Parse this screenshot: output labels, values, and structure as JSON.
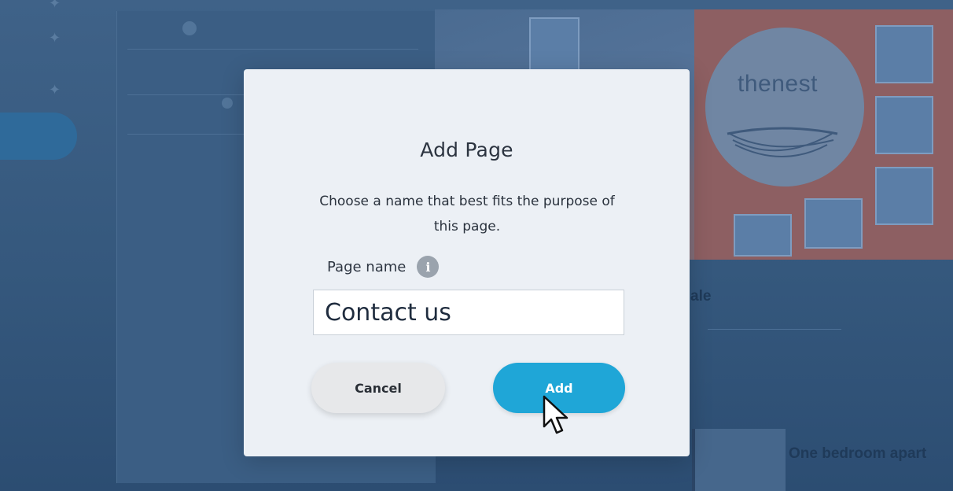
{
  "background": {
    "logo_text": "thenest",
    "heading_partial": "ale",
    "card_title": "One bedroom apart"
  },
  "dialog": {
    "title": "Add Page",
    "description": "Choose a name that best fits the purpose of this page.",
    "field_label": "Page name",
    "info_icon": "info-icon",
    "input_value": "Contact us",
    "cancel_label": "Cancel",
    "add_label": "Add"
  },
  "colors": {
    "accent": "#1fa6d7",
    "overlay": "#2e4f73",
    "dialog_bg": "#ecf0f5"
  }
}
